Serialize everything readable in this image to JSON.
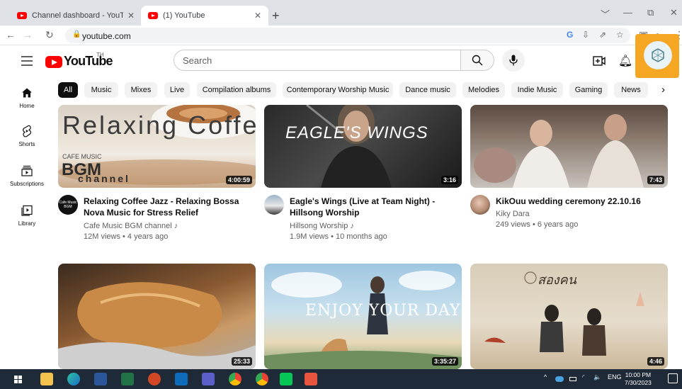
{
  "browser": {
    "tabs": [
      {
        "title": "Channel dashboard - YouTube St",
        "close": "✕",
        "active": false
      },
      {
        "title": "(1) YouTube",
        "close": "✕",
        "active": true
      }
    ],
    "new_tab": "+",
    "window_controls": {
      "dropdown": "﹀",
      "minimize": "—",
      "restore": "⧉",
      "close": "✕"
    },
    "url": "youtube.com",
    "nav_icons": [
      "back-icon",
      "forward-icon",
      "reload-icon",
      "lock-icon"
    ],
    "omnibox_icons": [
      "google-icon",
      "install-app-icon",
      "share-icon",
      "bookmark-star-icon",
      "split-screen-icon",
      "extension-icon",
      "menu-dots-icon"
    ]
  },
  "masthead": {
    "logo_text": "YouTube",
    "region_code": "TH",
    "search_placeholder": "Search"
  },
  "guide": {
    "items": [
      {
        "label": "Home",
        "icon": "home-icon"
      },
      {
        "label": "Shorts",
        "icon": "shorts-icon"
      },
      {
        "label": "Subscriptions",
        "icon": "subscriptions-icon"
      },
      {
        "label": "Library",
        "icon": "library-icon"
      }
    ]
  },
  "chips": [
    "All",
    "Music",
    "Mixes",
    "Live",
    "Compilation albums",
    "Contemporary Worship Music",
    "Dance music",
    "Melodies",
    "Indie Music",
    "Gaming",
    "News"
  ],
  "chip_next": "›",
  "videos": [
    {
      "title": "Relaxing Coffee Jazz - Relaxing Bossa Nova Music for Stress Relief",
      "channel": "Cafe Music BGM channel",
      "channel_badge": "♪",
      "meta": "12M views • 4 years ago",
      "duration": "4:00:59",
      "thumb_text": "Relaxing Coffee",
      "thumb_sub1": "CAFE MUSIC",
      "thumb_sub2": "BGM",
      "thumb_sub3": "channel",
      "avatar_text": "Cafe Music BGM"
    },
    {
      "title": "Eagle's Wings (Live at Team Night) - Hillsong Worship",
      "channel": "Hillsong Worship",
      "channel_badge": "♪",
      "meta": "1.9M views • 10 months ago",
      "duration": "3:16",
      "thumb_text": "EAGLE'S WINGS"
    },
    {
      "title": "KikOuu wedding ceremony 22.10.16",
      "channel": "Kiky Dara",
      "channel_badge": "",
      "meta": "249 views • 6 years ago",
      "duration": "7:43"
    },
    {
      "duration": "25:33"
    },
    {
      "duration": "3:35:27",
      "thumb_text": "ENJOY YOUR DAY"
    },
    {
      "duration": "4:46",
      "thumb_text": "สองคน"
    }
  ],
  "taskbar": {
    "apps": [
      "windows-start-icon",
      "file-explorer-icon",
      "edge-icon",
      "word-icon",
      "excel-icon",
      "powerpoint-icon",
      "outlook-icon",
      "teams-icon",
      "chrome-icon",
      "chrome-profile-icon",
      "line-icon",
      "app-icon"
    ],
    "tray": {
      "chevron": "^",
      "language": "ENG",
      "volume": "🔈"
    },
    "time": "10:00 PM",
    "date": "7/30/2023"
  }
}
